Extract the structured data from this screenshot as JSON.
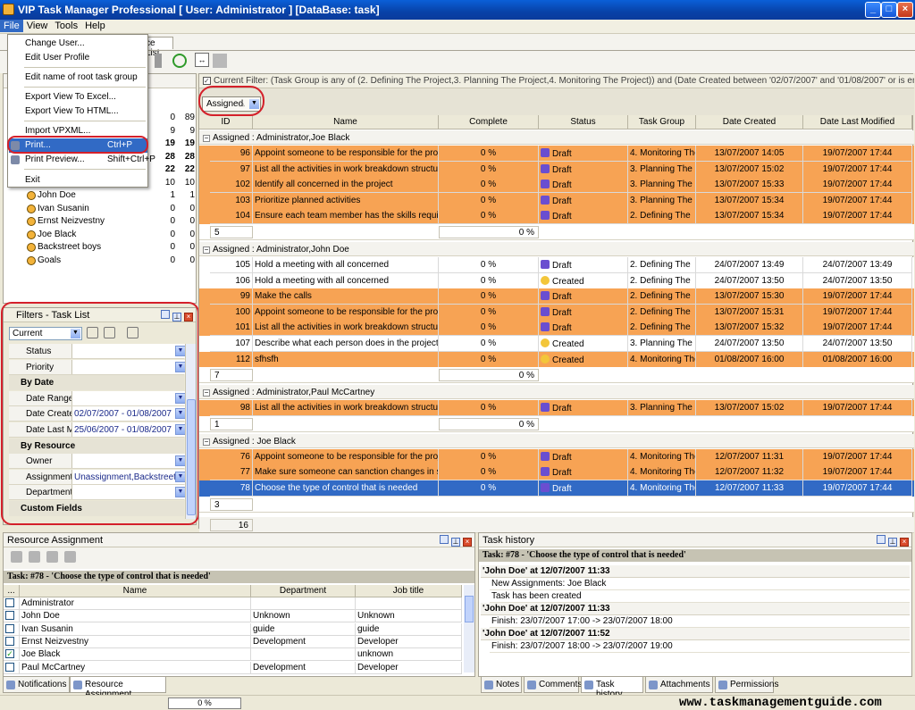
{
  "window": {
    "title": "VIP Task Manager Professional [ User: Administrator ] [DataBase: task]"
  },
  "menubar": [
    "File",
    "View",
    "Tools",
    "Help"
  ],
  "file_menu": [
    {
      "label": "Change User...",
      "shortcut": ""
    },
    {
      "label": "Edit User Profile",
      "shortcut": ""
    },
    {
      "label": "Edit name of root task group",
      "shortcut": ""
    },
    {
      "label": "Export View To Excel...",
      "shortcut": ""
    },
    {
      "label": "Export View To HTML...",
      "shortcut": ""
    },
    {
      "label": "Import VPXML...",
      "shortcut": ""
    },
    {
      "label": "Print...",
      "shortcut": "Ctrl+P"
    },
    {
      "label": "Print Preview...",
      "shortcut": "Shift+Ctrl+P"
    },
    {
      "label": "Exit",
      "shortcut": ""
    }
  ],
  "tab_partial": "ce List",
  "resource_tree": {
    "rows": [
      {
        "name": "",
        "c1": "0",
        "c2": "89",
        "bold": false
      },
      {
        "name": "",
        "c1": "9",
        "c2": "9",
        "bold": false
      },
      {
        "name": "",
        "c1": "19",
        "c2": "19",
        "bold": true
      },
      {
        "name": "",
        "c1": "28",
        "c2": "28",
        "bold": true
      },
      {
        "name": "",
        "c1": "22",
        "c2": "22",
        "bold": true
      },
      {
        "name": "",
        "c1": "10",
        "c2": "10",
        "bold": false
      },
      {
        "name": "John Doe",
        "c1": "1",
        "c2": "1",
        "bold": false
      },
      {
        "name": "Ivan Susanin",
        "c1": "0",
        "c2": "0",
        "bold": false
      },
      {
        "name": "Ernst Neizvestny",
        "c1": "0",
        "c2": "0",
        "bold": false
      },
      {
        "name": "Joe Black",
        "c1": "0",
        "c2": "0",
        "bold": false
      },
      {
        "name": "Backstreet boys",
        "c1": "0",
        "c2": "0",
        "bold": false
      },
      {
        "name": "Goals",
        "c1": "0",
        "c2": "0",
        "bold": false
      }
    ]
  },
  "filters_panel": {
    "title": "Filters - Task List",
    "current": "Current",
    "rows": [
      {
        "type": "field",
        "label": "Status",
        "value": ""
      },
      {
        "type": "field",
        "label": "Priority",
        "value": ""
      },
      {
        "type": "category",
        "label": "By Date"
      },
      {
        "type": "field",
        "label": "Date Range",
        "value": ""
      },
      {
        "type": "field",
        "label": "Date Create",
        "value": "02/07/2007 - 01/08/2007"
      },
      {
        "type": "field",
        "label": "Date Last M",
        "value": "25/06/2007 - 01/08/2007"
      },
      {
        "type": "category",
        "label": "By Resource"
      },
      {
        "type": "field",
        "label": "Owner",
        "value": ""
      },
      {
        "type": "field",
        "label": "Assignment",
        "value": "Unassignment,Backstreet bo"
      },
      {
        "type": "field",
        "label": "Department",
        "value": ""
      },
      {
        "type": "category",
        "label": "Custom Fields"
      }
    ]
  },
  "grid": {
    "filter_text": "Current Filter:  (Task Group is any of (2. Defining The Project,3. Planning The Project,4. Monitoring The Project)) and (Date Created between '02/07/2007' and '01/08/2007' or is empty) and (Date Modified",
    "group_button": "Assigned",
    "columns": [
      "ID",
      "Name",
      "Complete",
      "Status",
      "Task Group",
      "Date Created",
      "Date Last Modified"
    ],
    "groups": [
      {
        "caption": "Assigned : Administrator,Joe Black",
        "count": "5",
        "total": "0 %",
        "rows": [
          {
            "id": "96",
            "name": "Appoint someone to be responsible for the project",
            "complete": "0 %",
            "status": "Draft",
            "group": "4. Monitoring The",
            "created": "13/07/2007 14:05",
            "modified": "19/07/2007 17:44",
            "style": "orange"
          },
          {
            "id": "97",
            "name": "List all the activities in work breakdown structure",
            "complete": "0 %",
            "status": "Draft",
            "group": "3. Planning The",
            "created": "13/07/2007 15:02",
            "modified": "19/07/2007 17:44",
            "style": "orange"
          },
          {
            "id": "102",
            "name": "Identify all concerned in the project",
            "complete": "0 %",
            "status": "Draft",
            "group": "3. Planning The",
            "created": "13/07/2007 15:33",
            "modified": "19/07/2007 17:44",
            "style": "orange"
          },
          {
            "id": "103",
            "name": "Prioritize planned activities",
            "complete": "0 %",
            "status": "Draft",
            "group": "3. Planning The",
            "created": "13/07/2007 15:34",
            "modified": "19/07/2007 17:44",
            "style": "orange"
          },
          {
            "id": "104",
            "name": "Ensure each team member has the skills required",
            "complete": "0 %",
            "status": "Draft",
            "group": "2. Defining The",
            "created": "13/07/2007 15:34",
            "modified": "19/07/2007 17:44",
            "style": "orange"
          }
        ]
      },
      {
        "caption": "Assigned : Administrator,John Doe",
        "count": "7",
        "total": "0 %",
        "rows": [
          {
            "id": "105",
            "name": "Hold a meeting with all concerned",
            "complete": "0 %",
            "status": "Draft",
            "group": "2. Defining The",
            "created": "24/07/2007 13:49",
            "modified": "24/07/2007 13:49",
            "style": "white"
          },
          {
            "id": "106",
            "name": "Hold a meeting with all concerned",
            "complete": "0 %",
            "status": "Created",
            "group": "2. Defining The",
            "created": "24/07/2007 13:50",
            "modified": "24/07/2007 13:50",
            "style": "white"
          },
          {
            "id": "99",
            "name": "Make the calls",
            "complete": "0 %",
            "status": "Draft",
            "group": "2. Defining The",
            "created": "13/07/2007 15:30",
            "modified": "19/07/2007 17:44",
            "style": "orange"
          },
          {
            "id": "100",
            "name": "Appoint someone to be responsible for the project",
            "complete": "0 %",
            "status": "Draft",
            "group": "2. Defining The",
            "created": "13/07/2007 15:31",
            "modified": "19/07/2007 17:44",
            "style": "orange"
          },
          {
            "id": "101",
            "name": "List all the activities in work breakdown structure",
            "complete": "0 %",
            "status": "Draft",
            "group": "2. Defining The",
            "created": "13/07/2007 15:32",
            "modified": "19/07/2007 17:44",
            "style": "orange"
          },
          {
            "id": "107",
            "name": "Describe what each person does in the project",
            "complete": "0 %",
            "status": "Created",
            "group": "3. Planning The",
            "created": "24/07/2007 13:50",
            "modified": "24/07/2007 13:50",
            "style": "white"
          },
          {
            "id": "112",
            "name": "sfhsfh",
            "complete": "0 %",
            "status": "Created",
            "group": "4. Monitoring The",
            "created": "01/08/2007 16:00",
            "modified": "01/08/2007 16:00",
            "style": "orange"
          }
        ]
      },
      {
        "caption": "Assigned : Administrator,Paul McCartney",
        "count": "1",
        "total": "0 %",
        "rows": [
          {
            "id": "98",
            "name": "List all the activities in work breakdown structure",
            "complete": "0 %",
            "status": "Draft",
            "group": "3. Planning The",
            "created": "13/07/2007 15:02",
            "modified": "19/07/2007 17:44",
            "style": "orange"
          }
        ]
      },
      {
        "caption": "Assigned : Joe Black",
        "count": "3",
        "total": "",
        "rows": [
          {
            "id": "76",
            "name": "Appoint someone to be responsible for the project",
            "complete": "0 %",
            "status": "Draft",
            "group": "4. Monitoring The",
            "created": "12/07/2007 11:31",
            "modified": "19/07/2007 17:44",
            "style": "orange"
          },
          {
            "id": "77",
            "name": "Make sure someone can sanction changes in senior",
            "complete": "0 %",
            "status": "Draft",
            "group": "4. Monitoring The",
            "created": "12/07/2007 11:32",
            "modified": "19/07/2007 17:44",
            "style": "orange"
          },
          {
            "id": "78",
            "name": "Choose the type of control that is needed",
            "complete": "0 %",
            "status": "Draft",
            "group": "4. Monitoring The",
            "created": "12/07/2007 11:33",
            "modified": "19/07/2007 17:44",
            "style": "sel"
          }
        ]
      }
    ],
    "grand_total": "16"
  },
  "resource_assignment": {
    "title": "Resource Assignment",
    "task": "Task: #78 - 'Choose the type of control that is needed'",
    "columns": [
      "...",
      "Name",
      "Department",
      "Job title"
    ],
    "rows": [
      {
        "checked": false,
        "name": "Administrator",
        "dept": "",
        "job": ""
      },
      {
        "checked": false,
        "name": "John Doe",
        "dept": "Unknown",
        "job": "Unknown"
      },
      {
        "checked": false,
        "name": "Ivan Susanin",
        "dept": "guide",
        "job": "guide"
      },
      {
        "checked": false,
        "name": "Ernst Neizvestny",
        "dept": "Development",
        "job": "Developer"
      },
      {
        "checked": true,
        "name": "Joe Black",
        "dept": "",
        "job": "unknown"
      },
      {
        "checked": false,
        "name": "Paul McCartney",
        "dept": "Development",
        "job": "Developer"
      }
    ],
    "tabs": [
      "Notifications",
      "Resource Assignment"
    ]
  },
  "task_history": {
    "title": "Task history",
    "task": "Task: #78 - 'Choose the type of control that is needed'",
    "entries": [
      {
        "head": "'John Doe' at 12/07/2007 11:33",
        "lines": [
          "New Assignments: Joe Black",
          "Task has been created"
        ]
      },
      {
        "head": "'John Doe' at 12/07/2007 11:33",
        "lines": [
          "Finish: 23/07/2007 17:00 -> 23/07/2007 18:00"
        ]
      },
      {
        "head": "'John Doe' at 12/07/2007 11:52",
        "lines": [
          "Finish: 23/07/2007 18:00 -> 23/07/2007 19:00"
        ]
      }
    ],
    "tabs": [
      "Notes",
      "Comments",
      "Task history",
      "Attachments",
      "Permissions"
    ]
  },
  "statusbar": {
    "progress": "0 %"
  },
  "watermark": "www.taskmanagementguide.com",
  "colors": {
    "row_orange": "#f7a354",
    "selection": "#316ac5",
    "highlight_circle": "#d4202a"
  }
}
